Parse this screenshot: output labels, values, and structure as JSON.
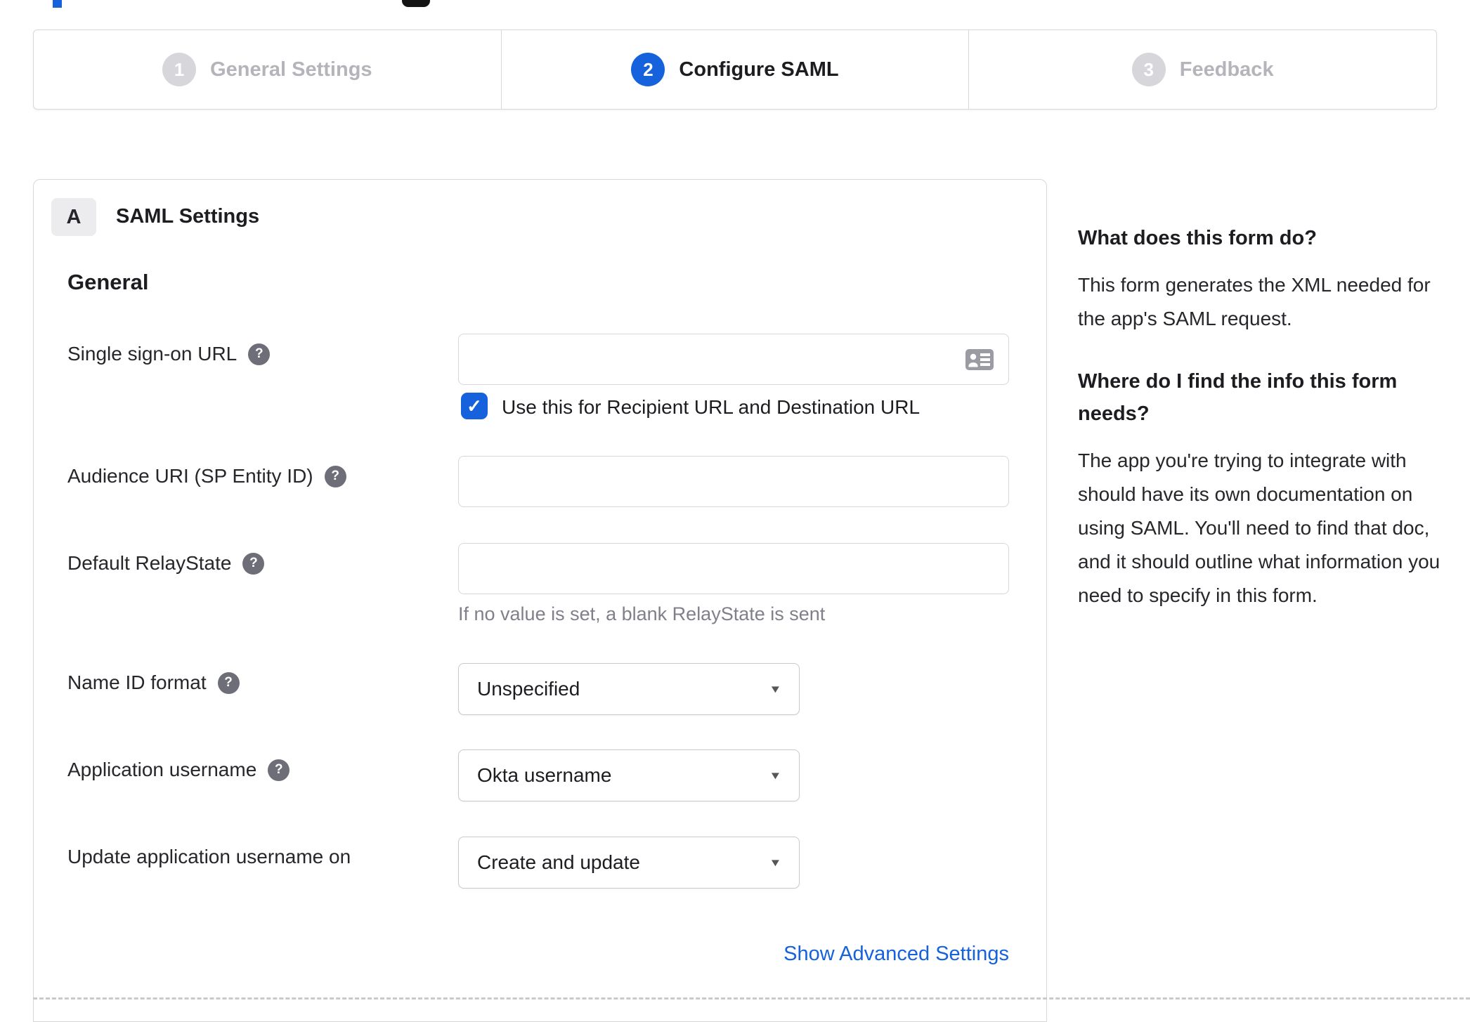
{
  "colors": {
    "accent_blue": "#1662dd",
    "inactive_gray": "#d6d6db",
    "border": "#d7d7dc"
  },
  "icons": {
    "help": "?",
    "check": "✓",
    "caret": "▼",
    "contact_card": "contact-card-icon"
  },
  "stepper": {
    "steps": [
      {
        "number": "1",
        "label": "General Settings",
        "state": "inactive"
      },
      {
        "number": "2",
        "label": "Configure SAML",
        "state": "active"
      },
      {
        "number": "3",
        "label": "Feedback",
        "state": "inactive"
      }
    ]
  },
  "panel": {
    "section_badge": "A",
    "section_title": "SAML Settings",
    "group_heading": "General",
    "fields": [
      {
        "label": "Single sign-on URL",
        "value": "",
        "checkbox_label": "Use this for Recipient URL and Destination URL",
        "checkbox_checked": true
      },
      {
        "label": "Audience URI (SP Entity ID)",
        "value": ""
      },
      {
        "label": "Default RelayState",
        "value": "",
        "hint": "If no value is set, a blank RelayState is sent"
      },
      {
        "label": "Name ID format",
        "value": "Unspecified"
      },
      {
        "label": "Application username",
        "value": "Okta username"
      },
      {
        "label": "Update application username on",
        "value": "Create and update"
      }
    ],
    "advanced_link": "Show Advanced Settings"
  },
  "sidebar": {
    "q1_title": "What does this form do?",
    "q1_body": "This form generates the XML needed for the app's SAML request.",
    "q2_title": "Where do I find the info this form needs?",
    "q2_body": "The app you're trying to integrate with should have its own documentation on using SAML. You'll need to find that doc, and it should outline what information you need to specify in this form."
  }
}
